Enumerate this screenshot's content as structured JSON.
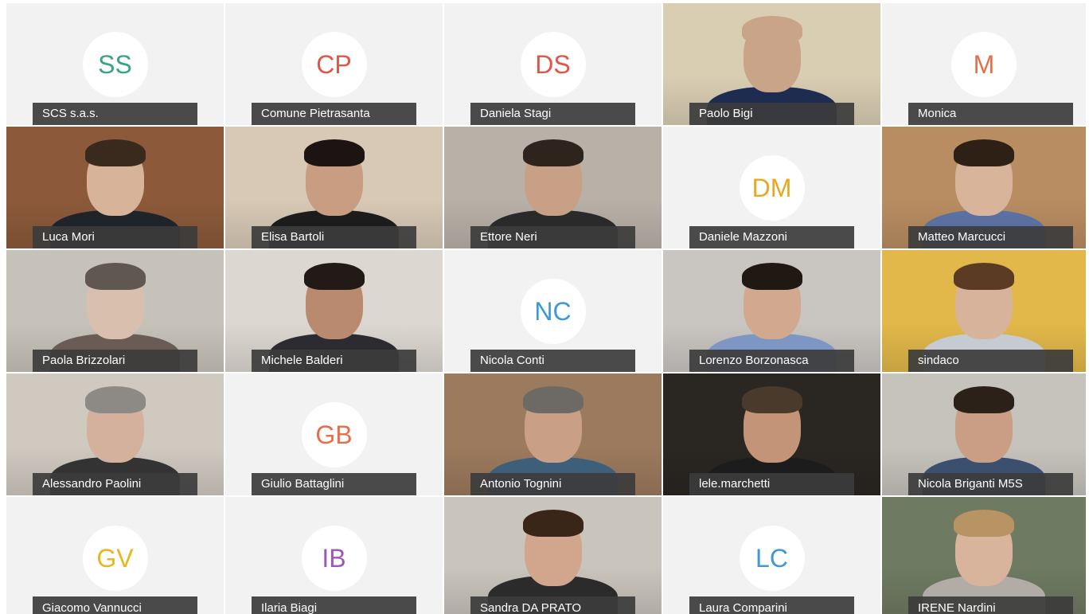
{
  "participants": [
    {
      "name": "SCS s.a.s.",
      "initials": "SS",
      "initials_color": "#3aa38b",
      "video": false
    },
    {
      "name": "Comune Pietrasanta",
      "initials": "CP",
      "initials_color": "#e2564a",
      "video": false
    },
    {
      "name": "Daniela Stagi",
      "initials": "DS",
      "initials_color": "#e2564a",
      "video": false
    },
    {
      "name": "Paolo Bigi",
      "video": true,
      "bg": "#d9cdb2",
      "skin": "#caa489",
      "hair": "#caa489",
      "shirt": "#1f2c52"
    },
    {
      "name": "Monica",
      "initials": "M",
      "initials_color": "#e3704b",
      "video": false
    },
    {
      "name": "Luca Mori",
      "video": true,
      "bg": "#8c5a3a",
      "skin": "#d7b399",
      "hair": "#3a2a1e",
      "shirt": "#1f242a"
    },
    {
      "name": "Elisa Bartoli",
      "video": true,
      "bg": "#d8c9b6",
      "skin": "#c99d81",
      "hair": "#1c1412",
      "shirt": "#1c1c1c"
    },
    {
      "name": "Ettore Neri",
      "video": true,
      "bg": "#b9b1a8",
      "skin": "#c8a085",
      "hair": "#2e241d",
      "shirt": "#2a2a2a"
    },
    {
      "name": "Daniele Mazzoni",
      "initials": "DM",
      "initials_color": "#e8a820",
      "video": false
    },
    {
      "name": "Matteo Marcucci",
      "video": true,
      "bg": "#b98d62",
      "skin": "#d8b49a",
      "hair": "#2f2015",
      "shirt": "#5b6fa0"
    },
    {
      "name": "Paola Brizzolari",
      "video": true,
      "bg": "#c7c2b9",
      "skin": "#d9bfae",
      "hair": "#5f5750",
      "shirt": "#6a5c54"
    },
    {
      "name": "Michele Balderi",
      "video": true,
      "bg": "#dcd7d1",
      "skin": "#b98a70",
      "hair": "#211a16",
      "shirt": "#2c2c30"
    },
    {
      "name": "Nicola Conti",
      "initials": "NC",
      "initials_color": "#3d9ad6",
      "video": false
    },
    {
      "name": "Lorenzo Borzonasca",
      "video": true,
      "bg": "#c9c6c2",
      "skin": "#d2a98e",
      "hair": "#1f1813",
      "shirt": "#7d96c4"
    },
    {
      "name": "sindaco",
      "video": true,
      "bg": "#e2b84a",
      "skin": "#d8b39b",
      "hair": "#5b3b24",
      "shirt": "#c6cbd3"
    },
    {
      "name": "Alessandro Paolini",
      "video": true,
      "bg": "#cfc9c0",
      "skin": "#d4b19c",
      "hair": "#8d8a86",
      "shirt": "#333333"
    },
    {
      "name": "Giulio Battaglini",
      "initials": "GB",
      "initials_color": "#e3704b",
      "video": false
    },
    {
      "name": "Antonio Tognini",
      "video": true,
      "bg": "#9c7a5e",
      "skin": "#c9a086",
      "hair": "#6d6a66",
      "shirt": "#3e5f7a"
    },
    {
      "name": "lele.marchetti",
      "video": true,
      "bg": "#2a2622",
      "skin": "#c49478",
      "hair": "#4a3a2c",
      "shirt": "#1c1c1c"
    },
    {
      "name": "Nicola Briganti M5S",
      "video": true,
      "bg": "#c6c2bc",
      "skin": "#c99e84",
      "hair": "#2b2119",
      "shirt": "#3b4f6e"
    },
    {
      "name": "Giacomo Vannucci",
      "initials": "GV",
      "initials_color": "#e8b720",
      "video": false
    },
    {
      "name": "Ilaria Biagi",
      "initials": "IB",
      "initials_color": "#9b58b5",
      "video": false
    },
    {
      "name": "Sandra DA PRATO",
      "video": true,
      "bg": "#c9c4bc",
      "skin": "#d2a68c",
      "hair": "#3a2618",
      "shirt": "#2b2b2b"
    },
    {
      "name": "Laura Comparini",
      "initials": "LC",
      "initials_color": "#3d9ad6",
      "video": false
    },
    {
      "name": "IRENE Nardini",
      "video": true,
      "bg": "#6f7a62",
      "skin": "#d8b49d",
      "hair": "#b89464",
      "shirt": "#b2aca6"
    }
  ]
}
